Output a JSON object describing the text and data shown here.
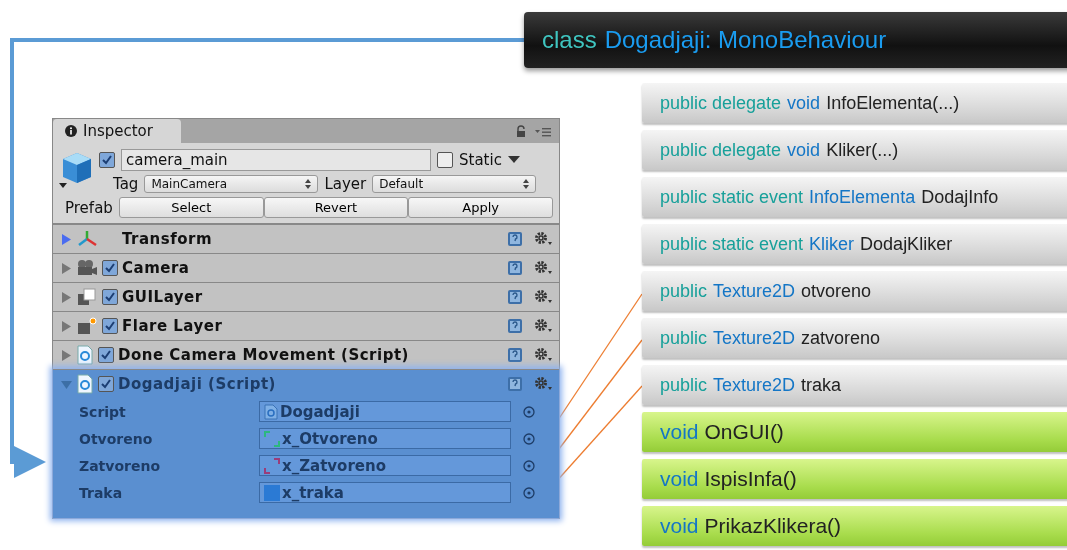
{
  "class_header": {
    "parts": [
      {
        "kind": "keyword",
        "text": "class"
      },
      {
        "kind": "type",
        "text": "Dogadjaji: MonoBehaviour"
      }
    ]
  },
  "inspector": {
    "tab": "Inspector",
    "object": {
      "active": true,
      "name": "camera_main",
      "static_label": "Static",
      "static": false,
      "tag_label": "Tag",
      "tag": "MainCamera",
      "layer_label": "Layer",
      "layer": "Default",
      "prefab_label": "Prefab",
      "prefab_buttons": [
        "Select",
        "Revert",
        "Apply"
      ]
    },
    "components": [
      {
        "kind": "transform",
        "name": "Transform",
        "expanded": false,
        "selected": false
      },
      {
        "kind": "camera",
        "name": "Camera",
        "enabled": true,
        "expanded": false,
        "selected": false
      },
      {
        "kind": "guilayer",
        "name": "GUILayer",
        "enabled": true,
        "expanded": false,
        "selected": false
      },
      {
        "kind": "flare",
        "name": "Flare Layer",
        "enabled": true,
        "expanded": false,
        "selected": false
      },
      {
        "kind": "script",
        "name": "Done Camera Movement (Script)",
        "enabled": true,
        "expanded": false,
        "selected": false
      },
      {
        "kind": "script",
        "name": "Dogadjaji (Script)",
        "enabled": true,
        "expanded": true,
        "selected": true,
        "properties": [
          {
            "label": "Script",
            "kind": "script",
            "value": "Dogadjaji"
          },
          {
            "label": "Otvoreno",
            "kind": "texture-open",
            "value": "x_Otvoreno"
          },
          {
            "label": "Zatvoreno",
            "kind": "texture-closed",
            "value": "x_Zatvoreno"
          },
          {
            "label": "Traka",
            "kind": "texture-solid",
            "value": "x_traka"
          }
        ]
      }
    ]
  },
  "members": [
    {
      "kind": "field",
      "parts": [
        {
          "kind": "keyword",
          "text": "public delegate"
        },
        {
          "kind": "type",
          "text": "void"
        },
        {
          "kind": "name",
          "text": "InfoElementa(...)"
        }
      ]
    },
    {
      "kind": "field",
      "parts": [
        {
          "kind": "keyword",
          "text": "public delegate"
        },
        {
          "kind": "type",
          "text": "void"
        },
        {
          "kind": "name",
          "text": "Kliker(...)"
        }
      ]
    },
    {
      "kind": "field",
      "parts": [
        {
          "kind": "keyword",
          "text": "public static event"
        },
        {
          "kind": "type",
          "text": "InfoElementa"
        },
        {
          "kind": "name",
          "text": "DodajInfo"
        }
      ]
    },
    {
      "kind": "field",
      "parts": [
        {
          "kind": "keyword",
          "text": "public static event"
        },
        {
          "kind": "type",
          "text": "Kliker"
        },
        {
          "kind": "name",
          "text": "DodajKliker"
        }
      ]
    },
    {
      "kind": "field",
      "parts": [
        {
          "kind": "keyword",
          "text": "public"
        },
        {
          "kind": "type",
          "text": "Texture2D"
        },
        {
          "kind": "name",
          "text": "otvoreno"
        }
      ]
    },
    {
      "kind": "field",
      "parts": [
        {
          "kind": "keyword",
          "text": "public"
        },
        {
          "kind": "type",
          "text": "Texture2D"
        },
        {
          "kind": "name",
          "text": "zatvoreno"
        }
      ]
    },
    {
      "kind": "field",
      "parts": [
        {
          "kind": "keyword",
          "text": "public"
        },
        {
          "kind": "type",
          "text": "Texture2D"
        },
        {
          "kind": "name",
          "text": "traka"
        }
      ]
    },
    {
      "kind": "method",
      "parts": [
        {
          "kind": "type",
          "text": "void"
        },
        {
          "kind": "name",
          "text": "OnGUI()"
        }
      ]
    },
    {
      "kind": "method",
      "parts": [
        {
          "kind": "type",
          "text": "void"
        },
        {
          "kind": "name",
          "text": "IspisInfa()"
        }
      ]
    },
    {
      "kind": "method",
      "parts": [
        {
          "kind": "type",
          "text": "void"
        },
        {
          "kind": "name",
          "text": "PrikazKlikera()"
        }
      ]
    }
  ]
}
